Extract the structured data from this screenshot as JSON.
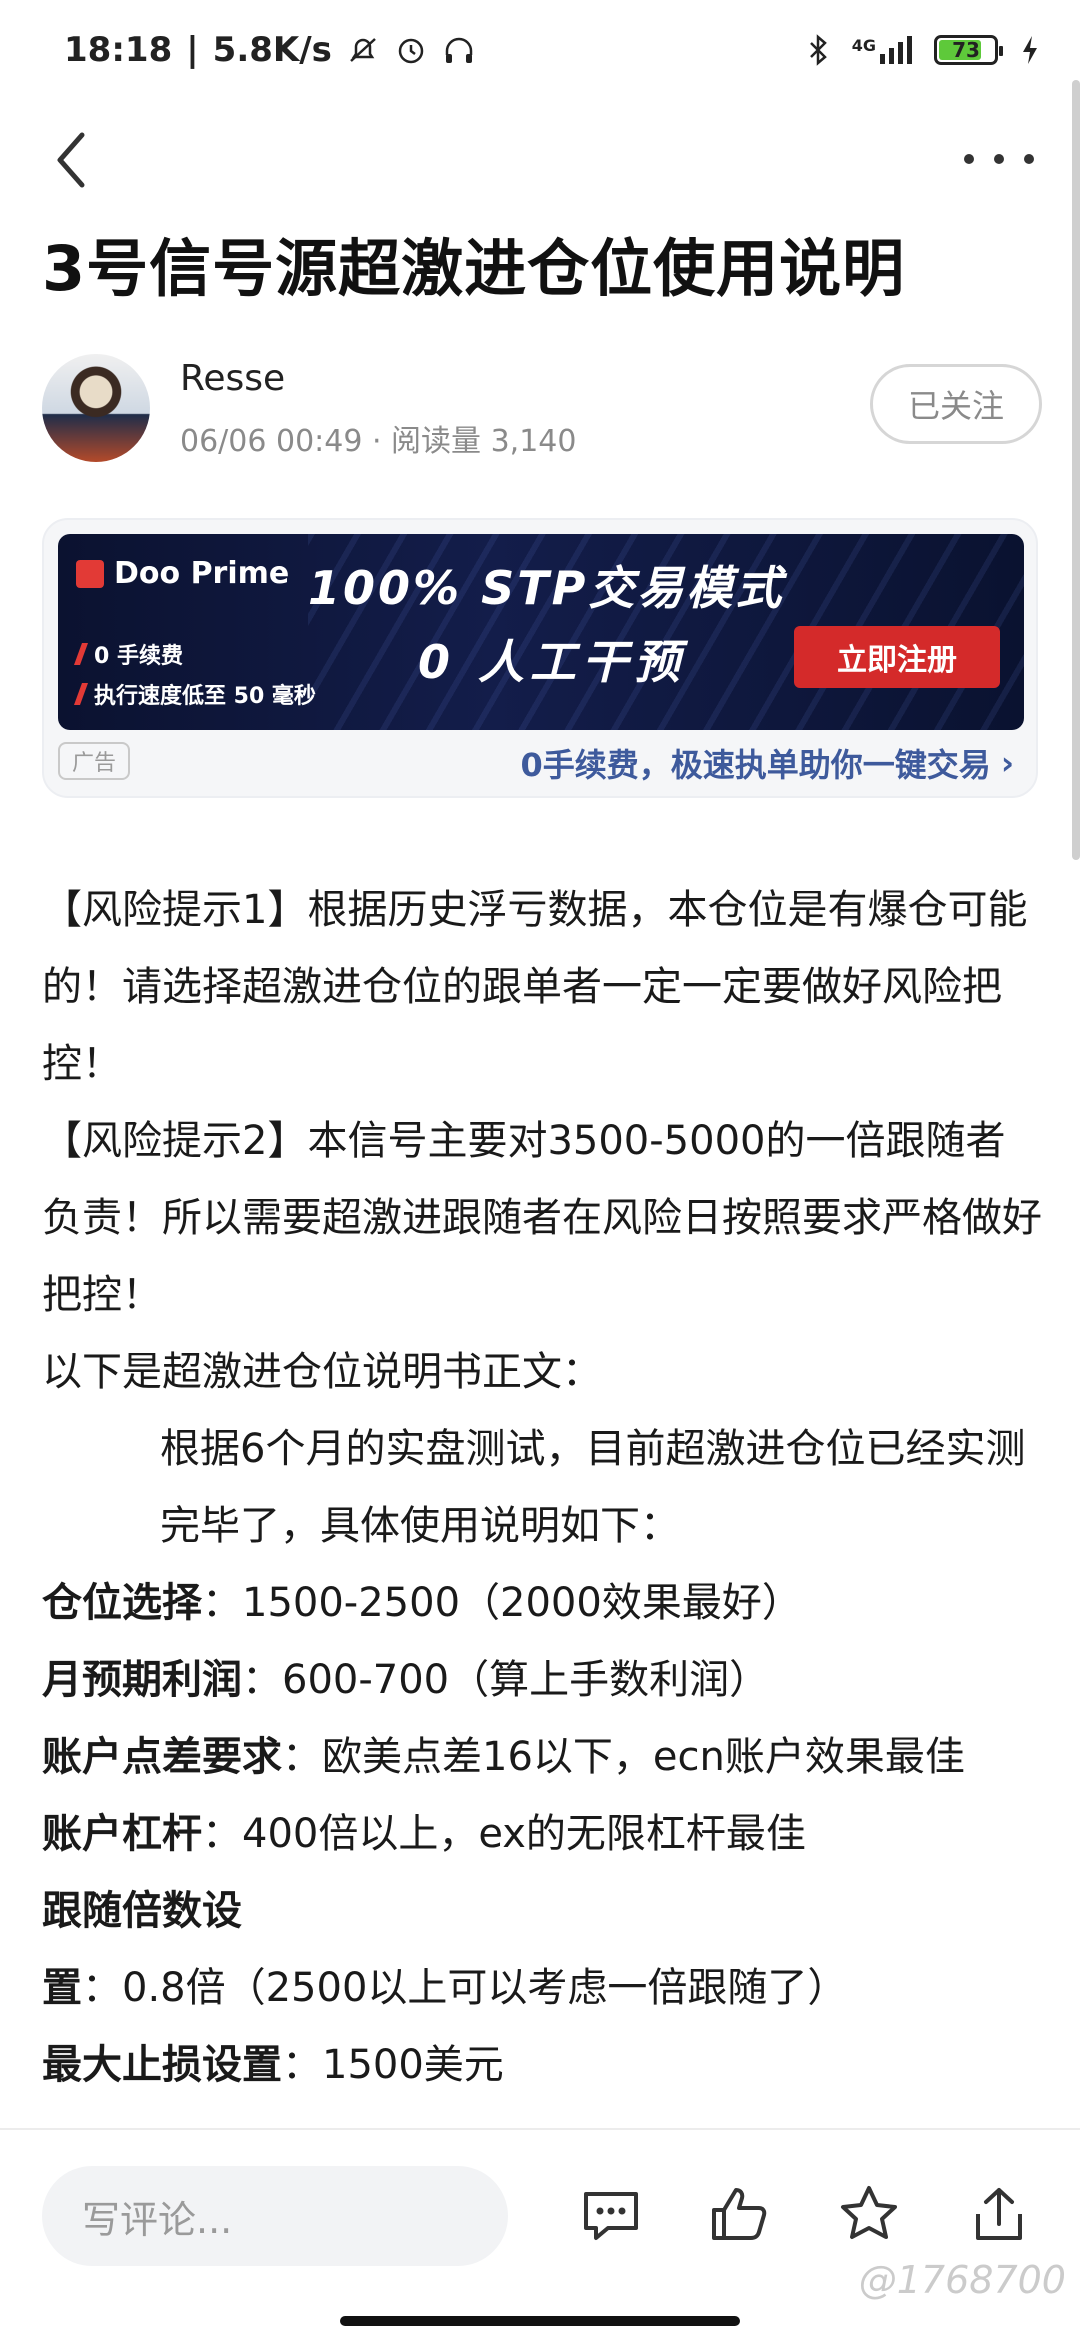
{
  "status_bar": {
    "time": "18:18",
    "speed": "5.8K/s",
    "network": "4G",
    "battery": "73",
    "battery_level": 0.73
  },
  "nav": {
    "back_icon": "chevron-left",
    "more_icon": "more-horizontal"
  },
  "article": {
    "title": "3号信号源超激进仓位使用说明"
  },
  "author": {
    "name": "Resse",
    "meta": "06/06 00:49 · 阅读量 3,140",
    "follow_label": "已关注"
  },
  "ad": {
    "brand": "Doo Prime",
    "feature1": "0 手续费",
    "feature2": "执行速度低至 50 毫秒",
    "headline": "100% STP交易模式",
    "subline": "0 人工干预",
    "cta": "立即注册",
    "tag": "广告",
    "link": "0手续费，极速执单助你一键交易",
    "link_arrow": "›"
  },
  "body": {
    "p1": "【风险提示1】根据历史浮亏数据，本仓位是有爆仓可能的！请选择超激进仓位的跟单者一定一定要做好风险把控！",
    "p2": "【风险提示2】本信号主要对3500-5000的一倍跟随者负责！所以需要超激进跟随者在风险日按照要求严格做好把控！",
    "p3": "以下是超激进仓位说明书正文：",
    "p4": "根据6个月的实盘测试，目前超激进仓位已经实测完毕了，具体使用说明如下：",
    "items": [
      {
        "label": "仓位选择",
        "value": "：1500-2500（2000效果最好）"
      },
      {
        "label": "月预期利润",
        "value": "：600-700（算上手数利润）"
      },
      {
        "label": "账户点差要求",
        "value": "：欧美点差16以下，ecn账户效果最佳"
      },
      {
        "label": "账户杠杆",
        "value": "：400倍以上，ex的无限杠杆最佳"
      },
      {
        "label": "跟随倍数设置",
        "value": "：0.8倍（2500以上可以考虑一倍跟随了）"
      },
      {
        "label": "最大止损设置",
        "value": "：1500美元"
      }
    ]
  },
  "bottom_bar": {
    "comment_placeholder": "写评论...",
    "icons": [
      "comment-icon",
      "like-icon",
      "favorite-icon",
      "share-icon"
    ]
  },
  "watermark": "@1768700"
}
